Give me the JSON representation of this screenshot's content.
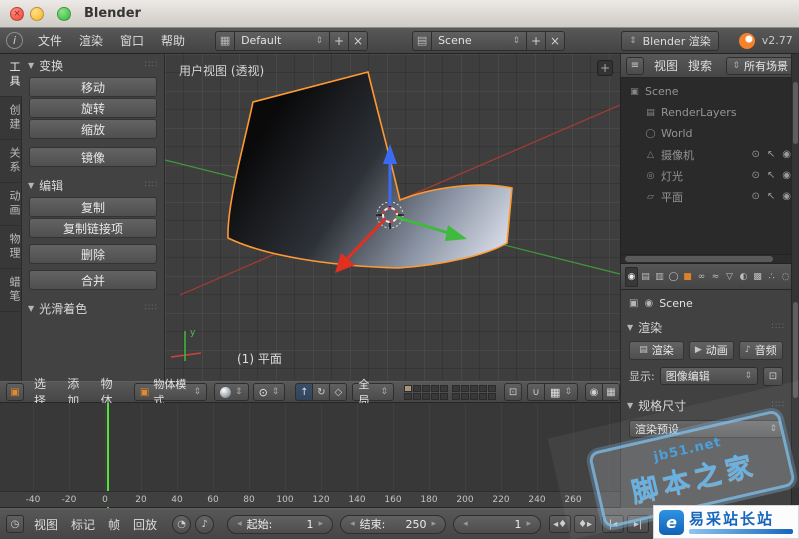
{
  "window": {
    "title": "Blender"
  },
  "infobar": {
    "menus": [
      "文件",
      "渲染",
      "窗口",
      "帮助"
    ],
    "layout_value": "Default",
    "scene_value": "Scene",
    "engine_value": "Blender 渲染",
    "version": "v2.77"
  },
  "toolshelf": {
    "tabs": [
      "工具",
      "创建",
      "关系",
      "动画",
      "物理",
      "蜡笔"
    ],
    "transform_title": "变换",
    "transform_buttons": [
      "移动",
      "旋转",
      "缩放",
      "镜像"
    ],
    "edit_title": "编辑",
    "edit_buttons": [
      "复制",
      "复制链接项",
      "删除",
      "合并"
    ],
    "shading_title": "光滑着色"
  },
  "viewport": {
    "view_label": "用户视图 (透视)",
    "object_label": "(1) 平面",
    "axis_label": "y"
  },
  "view3d_header": {
    "menus": [
      "选择",
      "添加",
      "物体"
    ],
    "mode_value": "物体模式",
    "orientation_value": "全局"
  },
  "timeline": {
    "ruler": [
      "-40",
      "-20",
      "0",
      "20",
      "40",
      "60",
      "80",
      "100",
      "120",
      "140",
      "160",
      "180",
      "200",
      "220",
      "240",
      "260"
    ],
    "menus": [
      "视图",
      "标记",
      "帧",
      "回放"
    ],
    "start_label": "起始:",
    "start_value": "1",
    "end_label": "结束:",
    "end_value": "250",
    "frame_value": "1"
  },
  "outliner": {
    "menus": [
      "视图",
      "搜索"
    ],
    "scope_value": "所有场景",
    "items": [
      {
        "icon": "▣",
        "label": "Scene"
      },
      {
        "icon": "▤",
        "label": "RenderLayers"
      },
      {
        "icon": "◯",
        "label": "World"
      },
      {
        "icon": "△",
        "label": "摄像机"
      },
      {
        "icon": "◎",
        "label": "灯光"
      },
      {
        "icon": "▱",
        "label": "平面"
      }
    ]
  },
  "properties": {
    "tab_icons": [
      "◉",
      "▤",
      "▥",
      "◯",
      "■",
      "∞",
      "≈",
      "▽",
      "◐",
      "▩",
      "∴",
      "◌"
    ],
    "context_value": "Scene",
    "render_title": "渲染",
    "render_button": "渲染",
    "animation_button": "动画",
    "audio_button": "音频",
    "display_label": "显示:",
    "display_value": "图像编辑",
    "dimensions_title": "规格尺寸",
    "preset_value": "渲染预设"
  },
  "watermark": {
    "stamp_line1": "jb51.net",
    "stamp_line2": "脚本之家",
    "logo_text": "易采站长站"
  },
  "icons": {
    "updown": "⇕",
    "plus": "+",
    "close": "×",
    "tri_down": "▼",
    "grip": "∷∷",
    "info": "i",
    "cube": "▣",
    "pivot": "⊙",
    "translate": "↑",
    "rotate": "↻",
    "scale": "◇",
    "lock": "⊡",
    "magnet": "∪",
    "snap": "▦",
    "cam": "◉",
    "clock": "◷",
    "sync": "◔",
    "note": "♪",
    "prev_key": "◂♦",
    "next_key": "♦▸",
    "jump_start": "|◂",
    "jump_end": "▸|",
    "eye": "⊙",
    "cursor": "↖",
    "image": "▤",
    "play": "▶",
    "list": "≡",
    "add_panel": "+"
  }
}
